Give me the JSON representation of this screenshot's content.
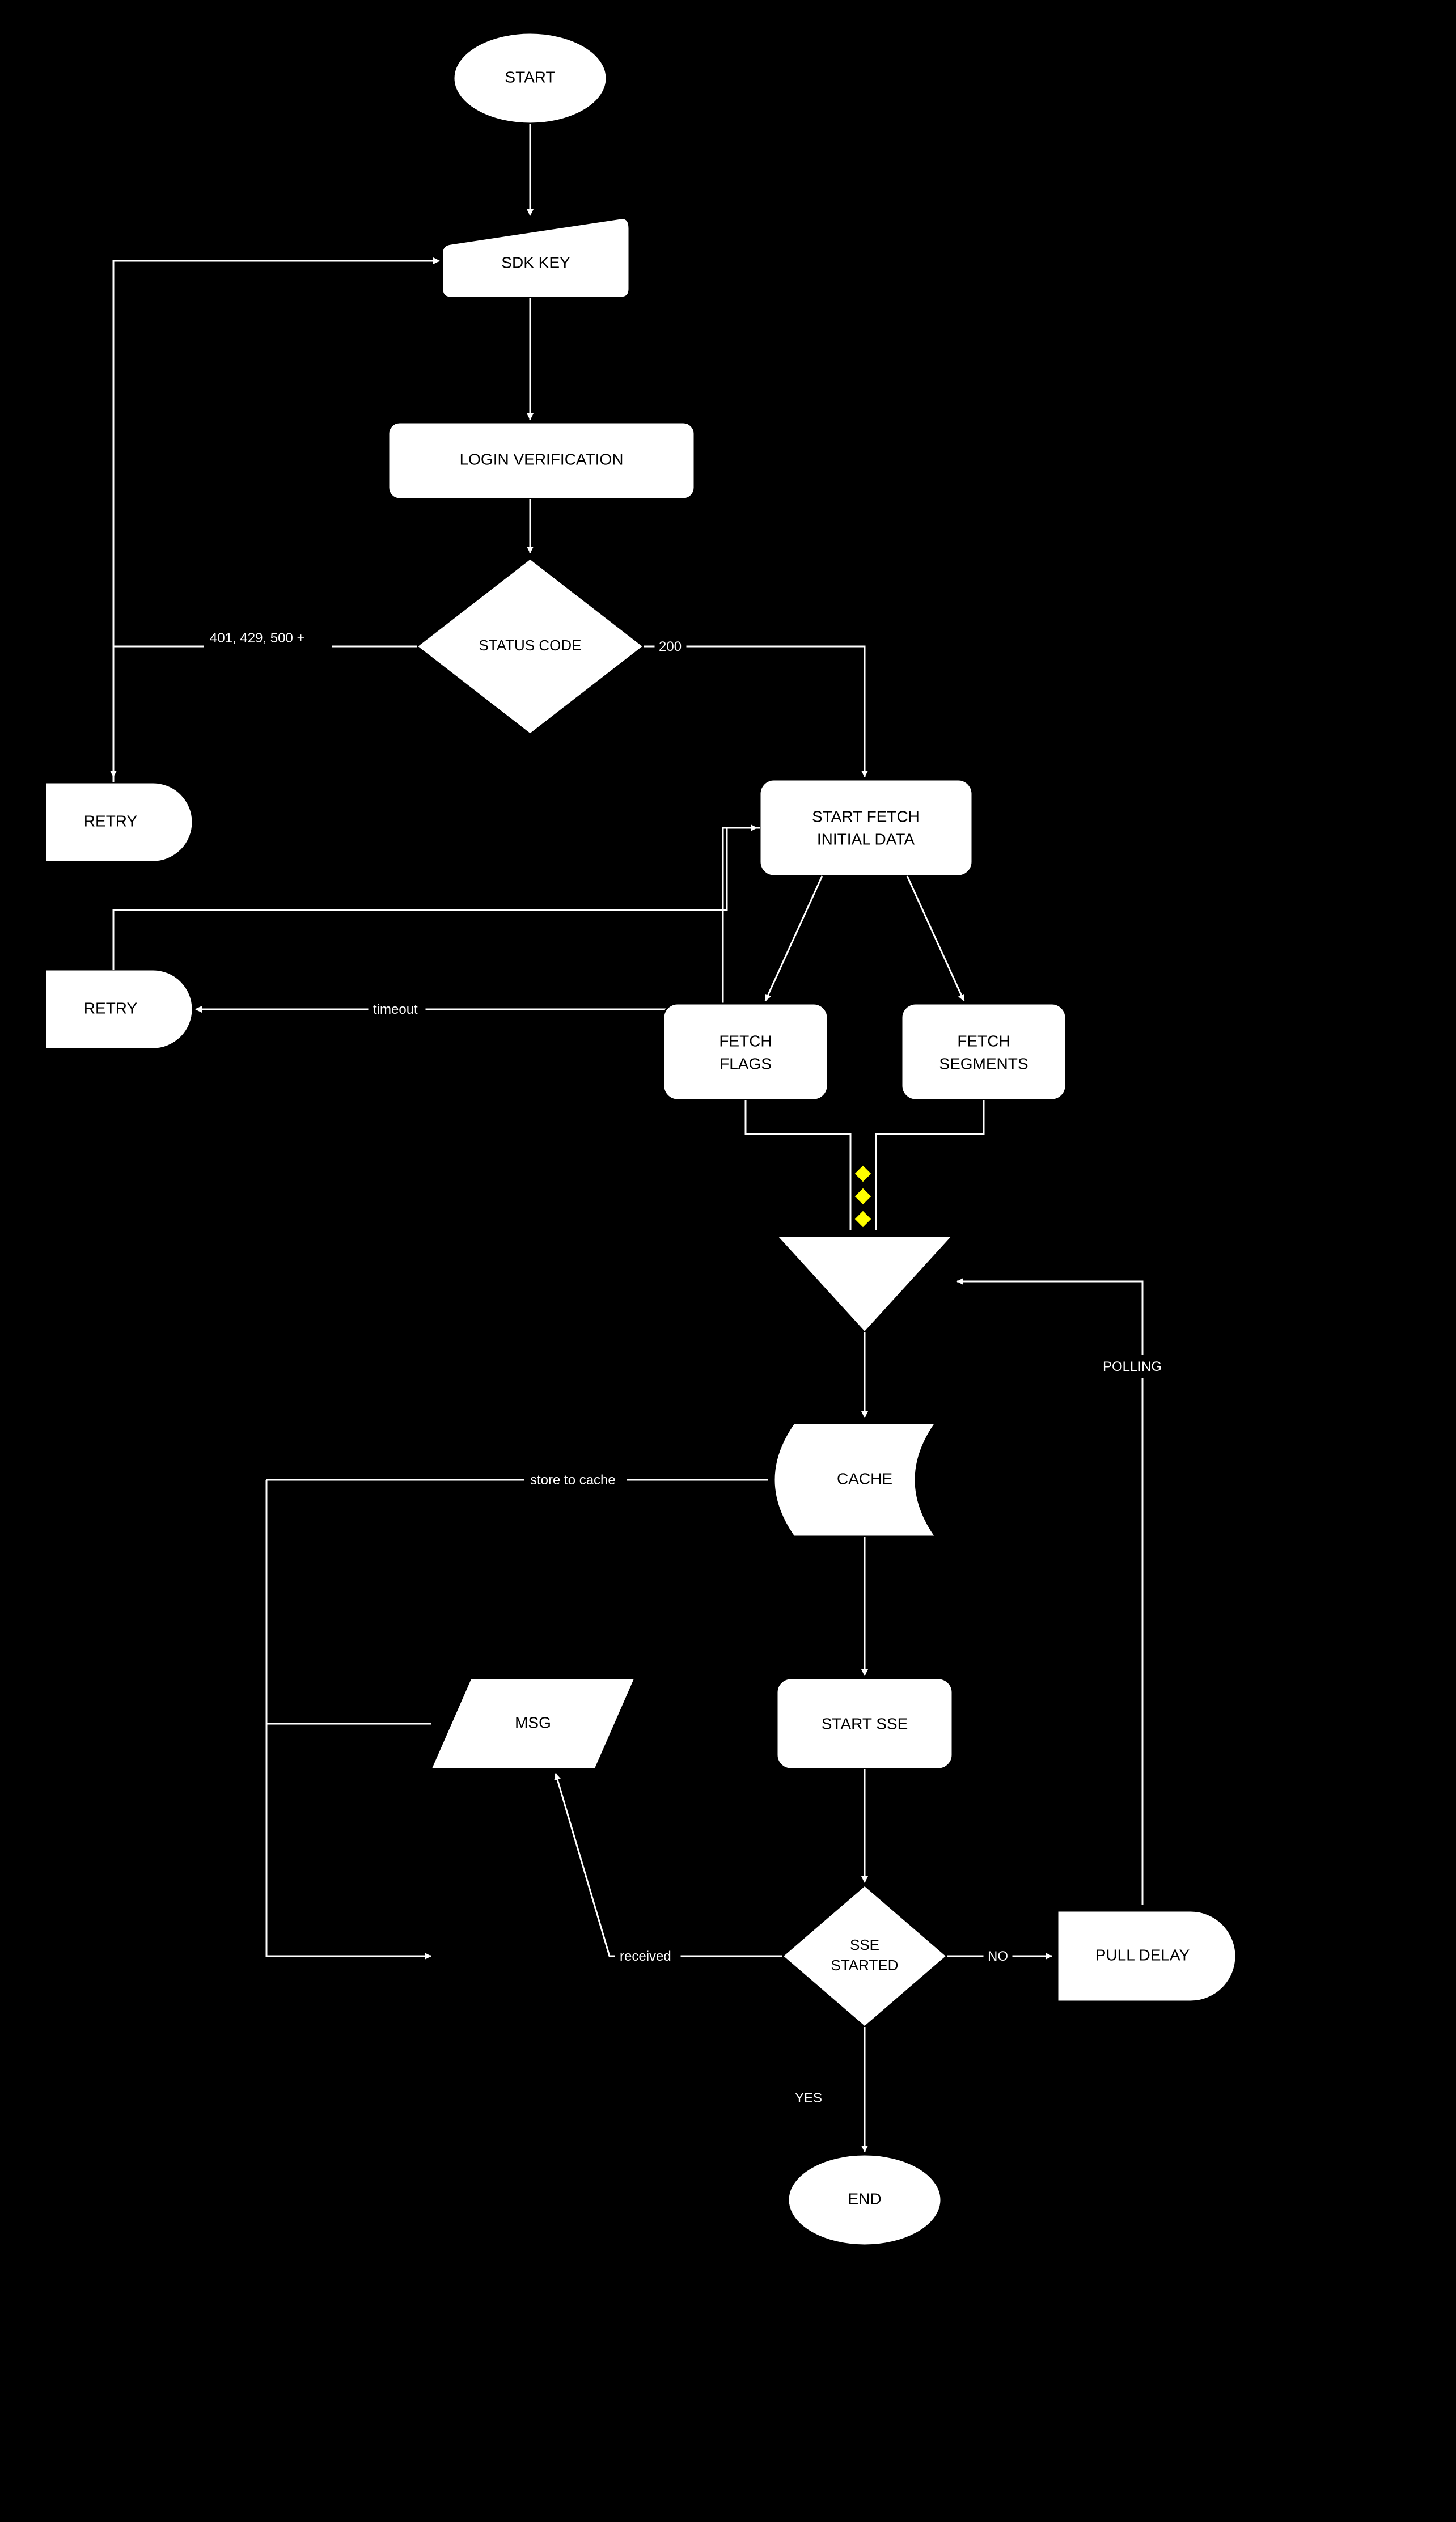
{
  "nodes": {
    "start": "START",
    "sdk_key": "SDK KEY",
    "login_verification": "LOGIN VERIFICATION",
    "status_code": "STATUS CODE",
    "retry1": "RETRY",
    "retry2": "RETRY",
    "start_fetch_line1": "START FETCH",
    "start_fetch_line2": "INITIAL DATA",
    "fetch_flags_line1": "FETCH",
    "fetch_flags_line2": "FLAGS",
    "fetch_segments_line1": "FETCH",
    "fetch_segments_line2": "SEGMENTS",
    "cache": "CACHE",
    "msg": "MSG",
    "start_sse": "START SSE",
    "sse_started_line1": "SSE",
    "sse_started_line2": "STARTED",
    "pull_delay": "PULL DELAY",
    "end": "END"
  },
  "edges": {
    "status_401": "401, 429, 500 +",
    "status_200": "200",
    "timeout": "timeout",
    "polling": "POLLING",
    "store_to_cache": "store to cache",
    "received": "received",
    "no": "NO",
    "yes": "YES"
  }
}
